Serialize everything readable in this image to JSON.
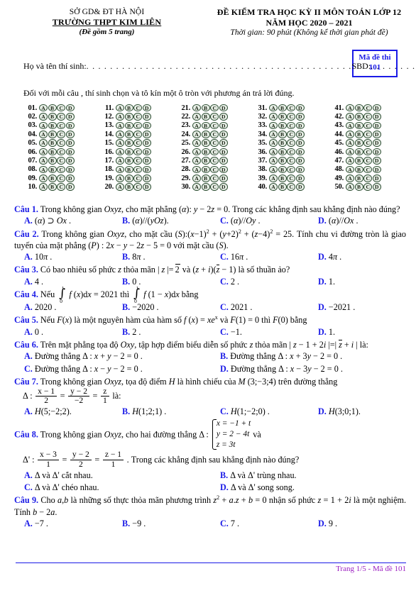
{
  "header": {
    "department": "SỞ GD& ĐT  HÀ NỘI",
    "school": "TRƯỜNG THPT KIM LIÊN",
    "pages_note": "(Đề gồm 5 trang)",
    "exam_title_line1": "ĐỀ KIỂM TRA HỌC KỲ II MÔN TOÁN LỚP 12",
    "exam_title_line2": "NĂM HỌC 2020 – 2021",
    "duration": "Thời gian: 90 phút (Không kể thời gian phát đề)"
  },
  "code_box": {
    "label": "Mã đề thi",
    "code": "101",
    "border_color": "#1a1ae6",
    "text_color": "#1a1ae6"
  },
  "candidate_line": {
    "name_label": "Họ và tên thí sinh:",
    "name_dots": ". . . . . . . . . . . . . . . . . . . . . . . . . . . . . . . . . . . . . . . . . . . . .",
    "sbd_label": "SBD:",
    "sbd_dots": ". . . . . . . . . . . . ."
  },
  "instruction": "Đối với mỗi câu , thí sinh chọn và tô kín một ô tròn với phương án trả lời đúng.",
  "answer_sheet": {
    "choices": [
      "A",
      "B",
      "C",
      "D"
    ],
    "bubble_fill": "#e8efe7",
    "bubble_border": "#2f4f34",
    "numbers": [
      "01",
      "02",
      "03",
      "04",
      "05",
      "06",
      "07",
      "08",
      "09",
      "10",
      "11",
      "12",
      "13",
      "14",
      "15",
      "16",
      "17",
      "18",
      "19",
      "20",
      "21",
      "22",
      "23",
      "24",
      "25",
      "26",
      "27",
      "28",
      "29",
      "30",
      "31",
      "32",
      "33",
      "34",
      "35",
      "36",
      "37",
      "38",
      "39",
      "40",
      "41",
      "42",
      "43",
      "44",
      "45",
      "46",
      "47",
      "48",
      "49",
      "50"
    ]
  },
  "questions": [
    {
      "label": "Câu 1.",
      "text_html": "Trong không gian <i class=\"v\">Oxyz</i>,  cho mặt phẳng <span>(<i class=\"v\">α</i>)</span>: <i class=\"v\">y</i> − 2<i class=\"v\">z</i> = 0. Trong các khẳng định sau khẳng định nào đúng?",
      "columns": 4,
      "options": [
        {
          "label": "A.",
          "html": "(<i class=\"v\">α</i>) ⊃ <i class=\"v\">Ox</i> ."
        },
        {
          "label": "B.",
          "html": "(<i class=\"v\">α</i>)//(<i class=\"v\">yOz</i>)."
        },
        {
          "label": "C.",
          "html": "(<i class=\"v\">α</i>)//<i class=\"v\">Oy</i> ."
        },
        {
          "label": "D.",
          "html": "(<i class=\"v\">α</i>)//<i class=\"v\">Ox</i> ."
        }
      ]
    },
    {
      "label": "Câu 2.",
      "text_html": "Trong không gian <i class=\"v\">Oxyz</i>, cho mặt cầu <span>(<i class=\"v\">S</i>)</span>:(<i class=\"v\">x</i>−1)<sup class=\"e\">2</sup> + (<i class=\"v\">y</i>+2)<sup class=\"e\">2</sup> + (<i class=\"v\">z</i>−4)<sup class=\"e\">2</sup> = 25. Tính chu vi đường tròn là giao tuyến của mặt phẳng (<i class=\"v\">P</i>) : 2<i class=\"v\">x</i> − <i class=\"v\">y</i> − 2<i class=\"v\">z</i> − 5 = 0 với mặt cầu (<i class=\"v\">S</i>).",
      "columns": 4,
      "options": [
        {
          "label": "A.",
          "html": "10<i class=\"v\">π</i> ."
        },
        {
          "label": "B.",
          "html": "8<i class=\"v\">π</i> ."
        },
        {
          "label": "C.",
          "html": "16<i class=\"v\">π</i> ."
        },
        {
          "label": "D.",
          "html": "4<i class=\"v\">π</i> ."
        }
      ]
    },
    {
      "label": "Câu 3.",
      "text_html": "Có bao nhiêu số phức <i class=\"v\">z</i> thỏa mãn | <i class=\"v\">z</i> |= <span class=\"sqrt\">2</span> và <span>(<i class=\"v\">z</i> + <i class=\"v\">i</i>)</span><span>(<span class=\"ovl\"><i class=\"v\">z</i></span> − 1)</span> là số thuần ảo?",
      "columns": 4,
      "options": [
        {
          "label": "A.",
          "html": "4 ."
        },
        {
          "label": "B.",
          "html": "0 ."
        },
        {
          "label": "C.",
          "html": "2 ."
        },
        {
          "label": "D.",
          "html": "1."
        }
      ]
    },
    {
      "label": "Câu 4.",
      "text_html": "Nếu INTEGRAL1 <i class=\"v\">f</i> (<i class=\"v\">x</i>)d<i class=\"v\">x</i> = 2021 thì INTEGRAL2 <i class=\"v\">f</i> (1 − <i class=\"v\">x</i>)d<i class=\"v\">x</i> bằng",
      "columns": 4,
      "options": [
        {
          "label": "A.",
          "html": "2020 ."
        },
        {
          "label": "B.",
          "html": "−2020 ."
        },
        {
          "label": "C.",
          "html": "2021 ."
        },
        {
          "label": "D.",
          "html": "−2021 ."
        }
      ]
    },
    {
      "label": "Câu 5.",
      "text_html": "Nếu <i class=\"v\">F</i>(<i class=\"v\">x</i>) là một nguyên hàm của hàm số <i class=\"v\">f</i> (<i class=\"v\">x</i>) = <i class=\"v\">xe</i><sup class=\"e\">x</sup> và <i class=\"v\">F</i>(1) = 0 thì <i class=\"v\">F</i>(0) bằng",
      "columns": 4,
      "options": [
        {
          "label": "A.",
          "html": "0 ."
        },
        {
          "label": "B.",
          "html": "2 ."
        },
        {
          "label": "C.",
          "html": "−1."
        },
        {
          "label": "D.",
          "html": "1."
        }
      ]
    },
    {
      "label": "Câu 6.",
      "text_html": "Trên mặt phẳng tọa độ <i class=\"v\">Oxy</i>,  tập hợp điểm biểu diễn số phức <i class=\"v\">z</i> thỏa mãn | <i class=\"v\">z</i> − 1 + 2<i class=\"v\">i</i> |=| <span class=\"ovl\"><i class=\"v\">z</i></span> + <i class=\"v\">i</i> | là:",
      "columns": 2,
      "options": [
        {
          "label": "A.",
          "html": "Đường thẳng Δ : <i class=\"v\">x</i> + <i class=\"v\">y</i> − 2 = 0 ."
        },
        {
          "label": "B.",
          "html": "Đường thẳng Δ : <i class=\"v\">x</i> + 3<i class=\"v\">y</i> − 2 = 0 ."
        },
        {
          "label": "C.",
          "html": "Đường thẳng Δ : <i class=\"v\">x</i> − <i class=\"v\">y</i> − 2 = 0 ."
        },
        {
          "label": "D.",
          "html": "Đường thẳng Δ : <i class=\"v\">x</i> − 3<i class=\"v\">y</i> − 2 = 0 ."
        }
      ]
    },
    {
      "label": "Câu 7.",
      "text_html": "Trong không gian <i class=\"v\">Oxyz</i>, tọa độ điểm <i class=\"v\">H</i> là hình chiếu của <i class=\"v\">M</i> (3;−3;4) trên đường thẳng",
      "text_html2": "Δ : FRACA = FRACB = FRACC là:",
      "columns": 4,
      "options": [
        {
          "label": "A.",
          "html": "<i class=\"v\">H</i>(5;−2;2)."
        },
        {
          "label": "B.",
          "html": "<i class=\"v\">H</i>(1;2;1) ."
        },
        {
          "label": "C.",
          "html": "<i class=\"v\">H</i>(1;−2;0) ."
        },
        {
          "label": "D.",
          "html": "<i class=\"v\">H</i>(3;0;1)."
        }
      ]
    },
    {
      "label": "Câu 8.",
      "text_html": "Trong không gian <i class=\"v\">Oxyz</i>,  cho hai đường thẳng Δ : SYSTEM và",
      "text_html2": "Δ' : FRACD = FRACE = FRACF . Trong các khẳng định sau khẳng định nào đúng?",
      "system_lines": [
        "x = −1 + t",
        "y = 2 − 4t",
        "z = 3t"
      ],
      "columns": 2,
      "options": [
        {
          "label": "A.",
          "html": "Δ và Δ' cắt nhau."
        },
        {
          "label": "B.",
          "html": "Δ và Δ' trùng nhau."
        },
        {
          "label": "C.",
          "html": "Δ và Δ' chéo nhau."
        },
        {
          "label": "D.",
          "html": "Δ và Δ' song song."
        }
      ]
    },
    {
      "label": "Câu 9.",
      "text_html": "Cho <i class=\"v\">a</i>,<i class=\"v\">b</i> là những số thực thỏa mãn phương trình <i class=\"v\">z</i><sup class=\"e\">2</sup> + <i class=\"v\">a</i>.<i class=\"v\">z</i> + <i class=\"v\">b</i> = 0  nhận số phức <i class=\"v\">z</i> = 1 + 2<i class=\"v\">i</i>  là một nghiệm. Tính <i class=\"v\">b</i> − 2<i class=\"v\">a</i>.",
      "columns": 4,
      "options": [
        {
          "label": "A.",
          "html": "−7 ."
        },
        {
          "label": "B.",
          "html": "−9 ."
        },
        {
          "label": "C.",
          "html": "7 ."
        },
        {
          "label": "D.",
          "html": "9 ."
        }
      ]
    }
  ],
  "fractions": {
    "q7": [
      {
        "num": "x − 1",
        "den": "2"
      },
      {
        "num": "y − 2",
        "den": "−2"
      },
      {
        "num": "z",
        "den": "1"
      }
    ],
    "q8": [
      {
        "num": "x − 3",
        "den": "1"
      },
      {
        "num": "y − 2",
        "den": "2"
      },
      {
        "num": "z − 1",
        "den": "1"
      }
    ]
  },
  "integrals": {
    "q4": [
      {
        "upper": "1",
        "lower": "0"
      },
      {
        "upper": "1",
        "lower": "0"
      }
    ]
  },
  "footer": {
    "text": "Trang 1/5 - Mã đề 101",
    "color": "#9b1fc1",
    "rule_color": "#1a1ae6"
  }
}
